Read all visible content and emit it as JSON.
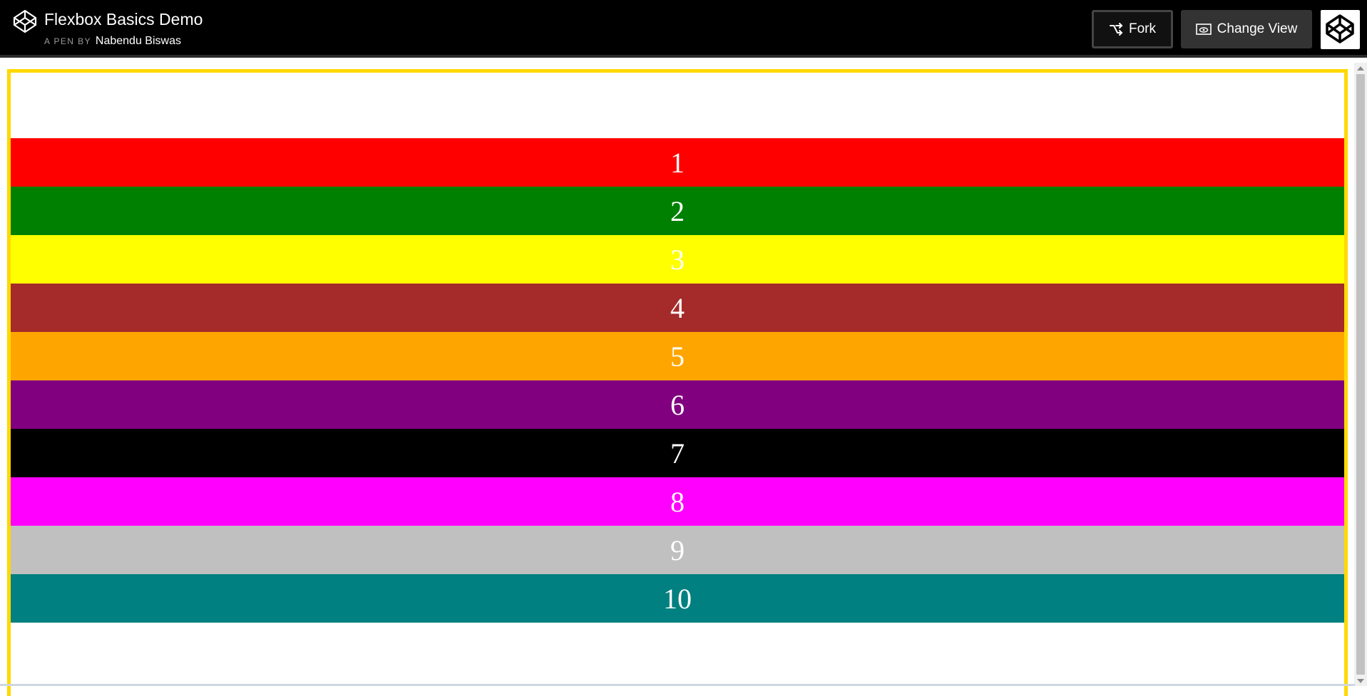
{
  "header": {
    "title": "Flexbox Basics Demo",
    "pen_by": "A PEN BY",
    "author": "Nabendu Biswas",
    "fork_label": "Fork",
    "change_view_label": "Change View"
  },
  "colors": {
    "header_bg": "#000000",
    "frame_border": "#ffd900"
  },
  "items": [
    {
      "label": "1",
      "color": "#ff0000"
    },
    {
      "label": "2",
      "color": "#008000"
    },
    {
      "label": "3",
      "color": "#ffff00"
    },
    {
      "label": "4",
      "color": "#a52a2a"
    },
    {
      "label": "5",
      "color": "#ffa500"
    },
    {
      "label": "6",
      "color": "#800080"
    },
    {
      "label": "7",
      "color": "#000000"
    },
    {
      "label": "8",
      "color": "#ff00ff"
    },
    {
      "label": "9",
      "color": "#c0c0c0"
    },
    {
      "label": "10",
      "color": "#008080"
    }
  ]
}
